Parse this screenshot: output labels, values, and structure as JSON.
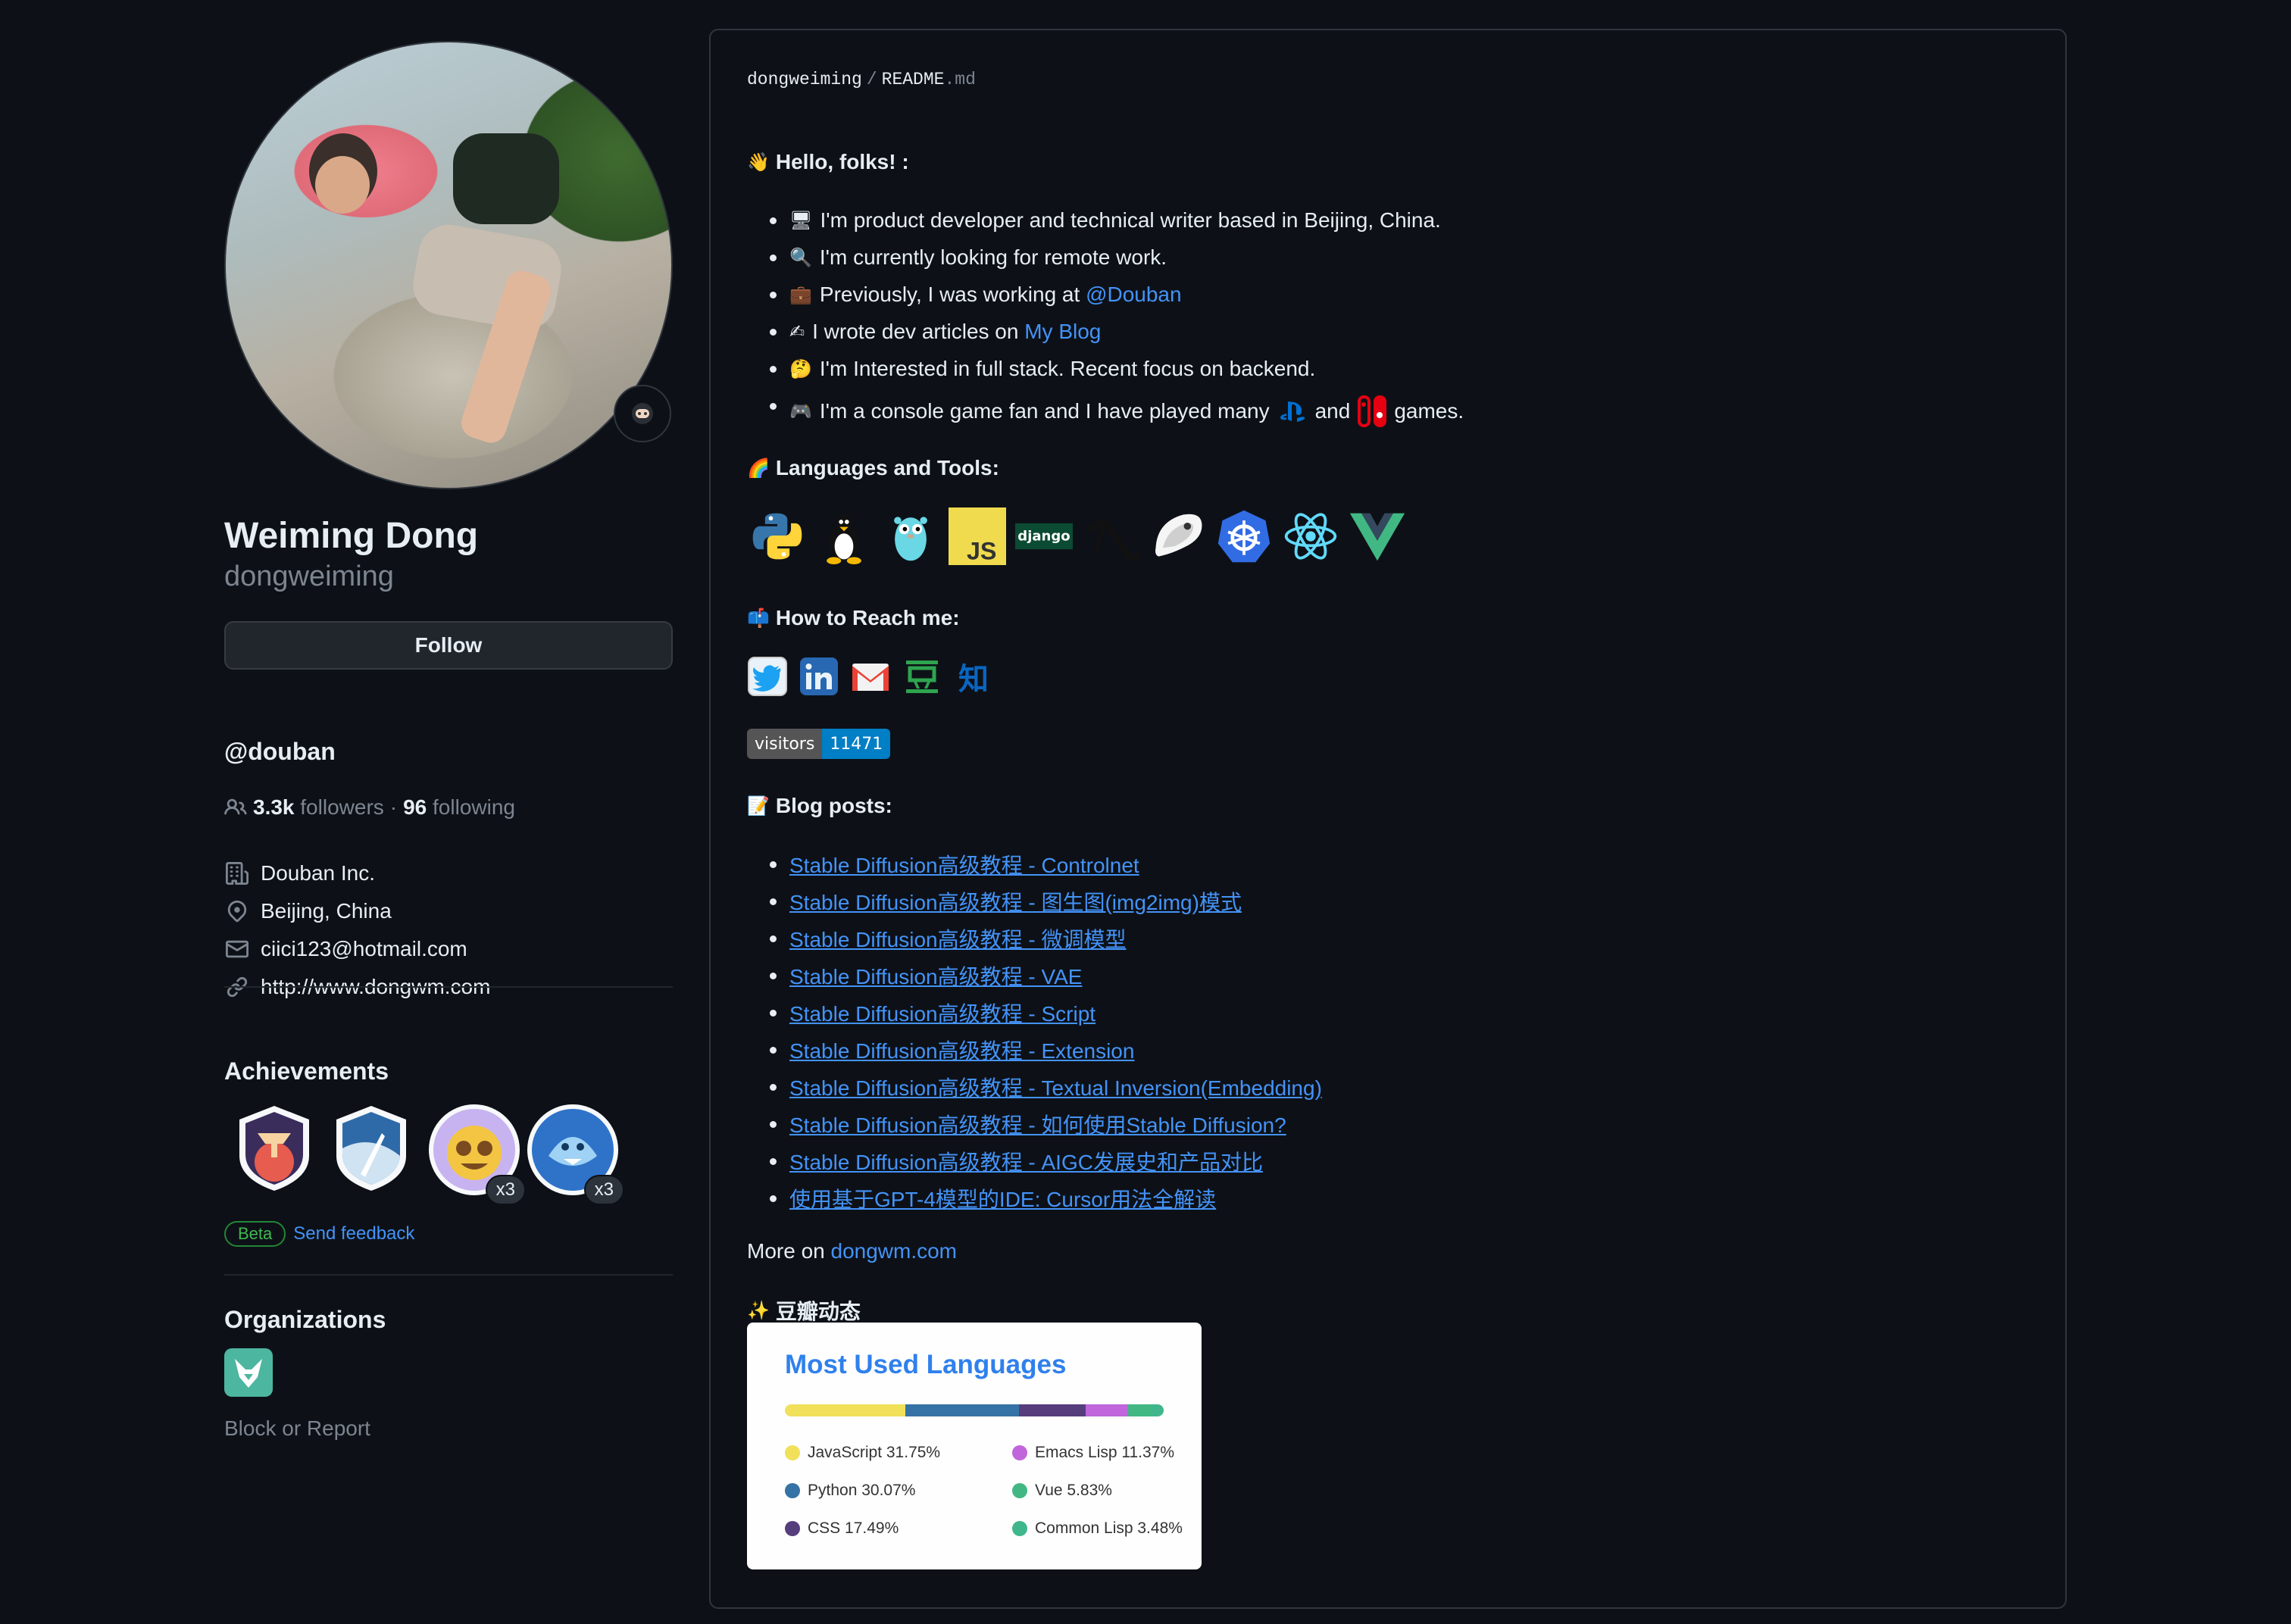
{
  "profile": {
    "name": "Weiming Dong",
    "login": "dongweiming",
    "follow_label": "Follow",
    "bio": "@douban",
    "followers_count": "3.3k",
    "followers_label": "followers",
    "dot": "·",
    "following_count": "96",
    "following_label": "following",
    "details": [
      {
        "icon": "organization-icon",
        "text": "Douban Inc."
      },
      {
        "icon": "location-icon",
        "text": "Beijing, China"
      },
      {
        "icon": "mail-icon",
        "text": "ciici123@hotmail.com"
      },
      {
        "icon": "link-icon",
        "text": "http://www.dongwm.com"
      }
    ]
  },
  "achievements": {
    "title": "Achievements",
    "badges": [
      {
        "name": "arctic-code-vault",
        "count": ""
      },
      {
        "name": "starstruck",
        "count": ""
      },
      {
        "name": "pull-shark-face",
        "count": "x3"
      },
      {
        "name": "pull-shark",
        "count": "x3"
      }
    ],
    "beta_label": "Beta",
    "feedback_label": "Send feedback"
  },
  "organizations": {
    "title": "Organizations",
    "block_label": "Block or Report"
  },
  "readme": {
    "owner": "dongweiming",
    "separator": "/",
    "file": "README",
    "ext": ".md",
    "hello": {
      "emoji": "👋",
      "text": "Hello, folks! :"
    },
    "about": [
      {
        "emoji": "🖥",
        "text": "I'm product developer and technical writer based in Beijing, China."
      },
      {
        "emoji": "🔍",
        "text": "I'm currently looking for remote work."
      },
      {
        "emoji": "💼",
        "text": "Previously, I was working at ",
        "link": "@Douban"
      },
      {
        "emoji": "✍",
        "text": "I wrote dev articles on ",
        "link": "My Blog"
      },
      {
        "emoji": "🤔",
        "text": "I'm Interested in full stack. Recent focus on backend."
      },
      {
        "emoji": "🎮",
        "text": "I'm a console game fan and I have played many",
        "and": "and",
        "tail": "games."
      }
    ],
    "tools_heading": {
      "emoji": "🌈",
      "text": "Languages and Tools:"
    },
    "tools": [
      "python-icon",
      "linux-icon",
      "go-icon",
      "javascript-icon",
      "django-icon",
      "emacs-lisp-icon",
      "gnome-icon",
      "kubernetes-icon",
      "react-icon",
      "vue-icon"
    ],
    "reach_heading": {
      "emoji": "📫",
      "text": "How to Reach me:"
    },
    "social": [
      "twitter-icon",
      "linkedin-icon",
      "gmail-icon",
      "douban-icon",
      "zhihu-icon"
    ],
    "visitors_label": "visitors",
    "visitors_count": "11471",
    "blog_heading": {
      "emoji": "📝",
      "text": "Blog posts:"
    },
    "posts": [
      "Stable Diffusion高级教程 - Controlnet",
      "Stable Diffusion高级教程 - 图生图(img2img)模式",
      "Stable Diffusion高级教程 - 微调模型",
      "Stable Diffusion高级教程 - VAE",
      "Stable Diffusion高级教程 - Script",
      "Stable Diffusion高级教程 - Extension",
      "Stable Diffusion高级教程 - Textual Inversion(Embedding)",
      "Stable Diffusion高级教程 - 如何使用Stable Diffusion?",
      "Stable Diffusion高级教程 - AIGC发展史和产品对比",
      "使用基于GPT-4模型的IDE: Cursor用法全解读"
    ],
    "more_prefix": "More on ",
    "more_link": "dongwm.com",
    "douban_heading": {
      "emoji": "✨",
      "text": "豆瓣动态"
    }
  },
  "languages_card": {
    "title": "Most Used Languages",
    "items": [
      {
        "name": "JavaScript",
        "percent": "31.75%",
        "value": 31.75,
        "color": "#f1e05a"
      },
      {
        "name": "Python",
        "percent": "30.07%",
        "value": 30.07,
        "color": "#3572A5"
      },
      {
        "name": "CSS",
        "percent": "17.49%",
        "value": 17.49,
        "color": "#563d7c"
      },
      {
        "name": "Emacs Lisp",
        "percent": "11.37%",
        "value": 11.37,
        "color": "#c065db"
      },
      {
        "name": "Vue",
        "percent": "5.83%",
        "value": 5.83,
        "color": "#41b883"
      },
      {
        "name": "Common Lisp",
        "percent": "3.48%",
        "value": 3.48,
        "color": "#3fb68b"
      }
    ]
  }
}
